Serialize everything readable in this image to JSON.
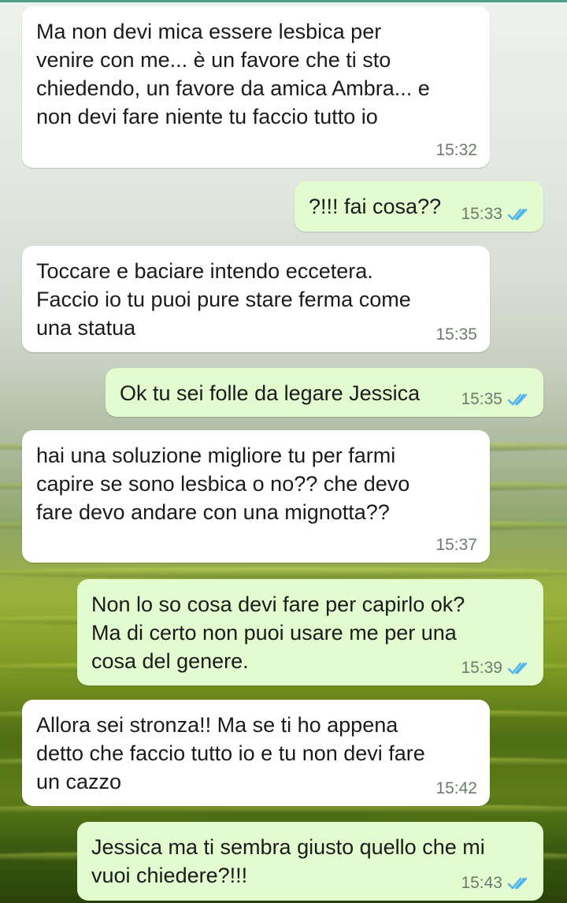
{
  "colors": {
    "incoming_bubble": "#ffffff",
    "outgoing_bubble": "#e2fbcf",
    "read_ticks": "#4fb3f0",
    "time_text": "#6e7a6d"
  },
  "messages": [
    {
      "direction": "in",
      "text": "Ma non devi mica essere lesbica per\nvenire con me... è un favore che ti sto\nchiedendo, un favore da amica Ambra... e\nnon devi fare niente tu faccio tutto io",
      "time": "15:32"
    },
    {
      "direction": "out",
      "text": "?!!! fai cosa??",
      "time": "15:33",
      "status_icon": "double-check-read-icon"
    },
    {
      "direction": "in",
      "text": "Toccare e baciare intendo eccetera.\nFaccio io tu puoi pure stare ferma come\nuna statua",
      "time": "15:35"
    },
    {
      "direction": "out",
      "text": "Ok tu sei folle da legare Jessica",
      "time": "15:35",
      "status_icon": "double-check-read-icon"
    },
    {
      "direction": "in",
      "text": "hai una soluzione migliore tu per farmi\ncapire se sono lesbica o no?? che devo\nfare devo andare con una mignotta??",
      "time": "15:37"
    },
    {
      "direction": "out",
      "text": "Non lo so cosa devi fare per capirlo ok?\nMa di certo non puoi usare me per una\ncosa del genere.",
      "time": "15:39",
      "status_icon": "double-check-read-icon"
    },
    {
      "direction": "in",
      "text": "Allora sei stronza!! Ma se ti ho appena\ndetto che faccio tutto io e tu non devi fare\nun cazzo",
      "time": "15:42"
    },
    {
      "direction": "out",
      "text": "Jessica ma ti sembra giusto quello che mi\nvuoi chiedere?!!!",
      "time": "15:43",
      "status_icon": "double-check-read-icon"
    }
  ]
}
